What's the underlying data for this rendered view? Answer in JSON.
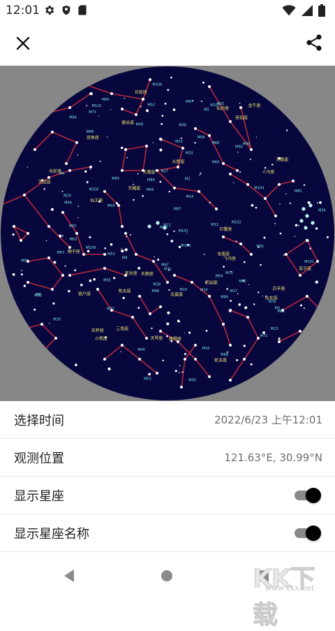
{
  "status_bar": {
    "time": "12:01",
    "left_icons": [
      "gear-icon",
      "shield-icon",
      "sd-card-icon"
    ],
    "right_icons": [
      "wifi-icon",
      "signal-icon",
      "battery-icon"
    ]
  },
  "app_bar": {
    "close_icon": "close-icon",
    "share_icon": "share-icon"
  },
  "sky_map": {
    "background_color": "#878787",
    "sky_color": "#07073e",
    "line_color": "#b8283a",
    "label_color": "#e8e070",
    "messier_color": "#7ee6e6",
    "constellation_labels": [
      "大熊座",
      "小熊座",
      "天龙座",
      "仙王座",
      "仙后座",
      "英仙座",
      "御夫座",
      "双子座",
      "巨蟹座",
      "狮子座",
      "室女座",
      "牧夫座",
      "北冕座",
      "武仙座",
      "天琴座",
      "天鹅座",
      "天鹰座",
      "飞马座",
      "仙女座",
      "三角座",
      "白羊座",
      "金牛座",
      "猎户座",
      "天蝎座",
      "人马座",
      "摩羯座",
      "宝瓶座",
      "双鱼座",
      "蛇夫座",
      "巨蛇座",
      "天秤座",
      "长蛇座",
      "天鹅座"
    ],
    "messier_labels": [
      "M39",
      "M52",
      "M103",
      "M76",
      "M34",
      "M31",
      "M33",
      "M110",
      "M15",
      "M2",
      "M13",
      "M92",
      "M57",
      "M56",
      "M27",
      "M71",
      "M11",
      "M16",
      "M17",
      "M8",
      "M20",
      "M22",
      "M28",
      "M54",
      "M55",
      "M75",
      "M30",
      "M72",
      "M73",
      "M10",
      "M12",
      "M14",
      "M9",
      "M4",
      "M80",
      "M19",
      "M62",
      "M107",
      "M5",
      "M3",
      "M53",
      "M64",
      "M85",
      "M88",
      "M91",
      "M100",
      "M98",
      "M99",
      "M84",
      "M86",
      "M87",
      "M89",
      "M90",
      "M58",
      "M59",
      "M60",
      "M49",
      "M61",
      "M104",
      "M68",
      "M83",
      "M51",
      "M63",
      "M94",
      "M106",
      "M101",
      "M102",
      "M108",
      "M97",
      "M109",
      "M81",
      "M82",
      "M40",
      "M44",
      "M67",
      "M48"
    ]
  },
  "settings": [
    {
      "label": "选择时间",
      "value": "2022/6/23 上午12:01",
      "type": "value"
    },
    {
      "label": "观测位置",
      "value": "121.63°E, 30.99°N",
      "type": "value"
    },
    {
      "label": "显示星座",
      "on": true,
      "type": "toggle"
    },
    {
      "label": "显示星座名称",
      "on": true,
      "type": "toggle"
    }
  ],
  "nav_bar": {
    "back_icon": "back-icon",
    "home_icon": "home-icon",
    "recents_icon": "recents-icon"
  },
  "watermark": {
    "text": "KK下载",
    "url": "www.kkx.net"
  }
}
